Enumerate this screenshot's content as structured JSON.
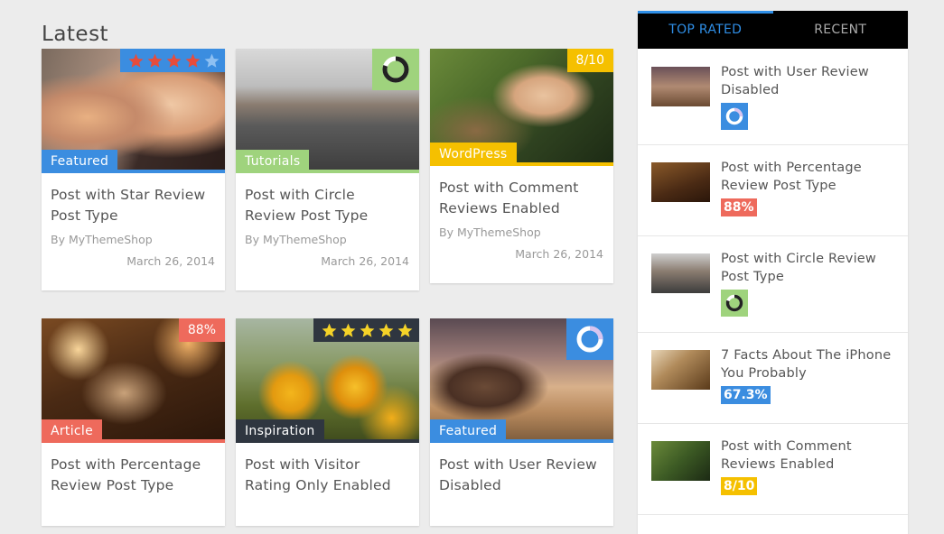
{
  "section_title": "Latest",
  "colors": {
    "blue": "#3b8de0",
    "green": "#9fd37d",
    "yellow": "#f5c000",
    "red": "#ee6a5c",
    "dark": "#2f3640",
    "star_red": "#e74c3c",
    "star_yellow": "#f5d328"
  },
  "posts": [
    {
      "title": "Post with Star Review Post Type",
      "author": "By MyThemeShop",
      "date": "March 26, 2014",
      "category": "Featured",
      "category_color": "#3b8de0",
      "review": {
        "type": "stars",
        "rating": 4,
        "max": 5
      }
    },
    {
      "title": "Post with Circle Review Post Type",
      "author": "By MyThemeShop",
      "date": "March 26, 2014",
      "category": "Tutorials",
      "category_color": "#9fd37d",
      "review": {
        "type": "circle",
        "fraction": 0.8
      }
    },
    {
      "title": "Post with Comment Reviews Enabled",
      "author": "By MyThemeShop",
      "date": "March 26, 2014",
      "category": "WordPress",
      "category_color": "#f5c000",
      "review": {
        "type": "score",
        "label": "8/10"
      }
    },
    {
      "title": "Post with Percentage Review Post Type",
      "category": "Article",
      "category_color": "#ee6a5c",
      "review": {
        "type": "percent",
        "label": "88%"
      }
    },
    {
      "title": "Post with Visitor Rating Only Enabled",
      "category": "Inspiration",
      "category_color": "#2f3640",
      "review": {
        "type": "stars",
        "rating": 5,
        "max": 5
      }
    },
    {
      "title": "Post with User Review Disabled",
      "category": "Featured",
      "category_color": "#3b8de0",
      "review": {
        "type": "circle",
        "fraction": 0.25
      }
    }
  ],
  "sidebar": {
    "tabs": [
      {
        "label": "TOP RATED",
        "active": true
      },
      {
        "label": "RECENT",
        "active": false
      }
    ],
    "items": [
      {
        "title": "Post with User Review Disabled",
        "review": {
          "type": "circle",
          "fraction": 0.25,
          "color": "#3b8de0"
        }
      },
      {
        "title": "Post with Percentage Review Post Type",
        "review": {
          "type": "badge",
          "label": "88%",
          "color": "#ee6a5c"
        }
      },
      {
        "title": "Post with Circle Review Post Type",
        "review": {
          "type": "circle",
          "fraction": 0.8,
          "color": "#9fd37d"
        }
      },
      {
        "title": "7 Facts About The iPhone You Probably",
        "review": {
          "type": "badge",
          "label": "67.3%",
          "color": "#3b8de0"
        }
      },
      {
        "title": "Post with Comment Reviews Enabled",
        "review": {
          "type": "badge",
          "label": "8/10",
          "color": "#f5c000"
        }
      }
    ]
  }
}
